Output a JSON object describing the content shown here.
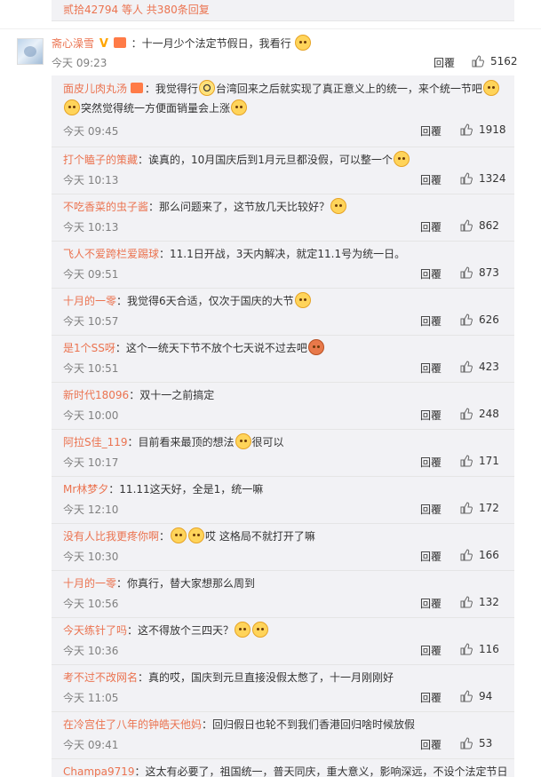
{
  "top": {
    "text": "贰拾42794 等人 共380条回复"
  },
  "comment": {
    "username": "斋心澡雪",
    "verified": "V",
    "text": "：十一月少个法定节假日，我看行",
    "time": "今天 09:23",
    "reply_label": "回覆",
    "likes": "5162"
  },
  "replies": [
    {
      "name": "面皮儿肉丸汤",
      "pre": "",
      "text": "：我觉得行",
      "text2": "台湾回来之后就实现了真正意义上的统一，来个统一节吧",
      "text3": "突然觉得统一方便面销量会上涨",
      "time": "今天 09:45",
      "reply": "回覆",
      "likes": "1918"
    },
    {
      "name": "打个瞌子的策藏",
      "text": "：诶真的，10月国庆后到1月元旦都没假，可以整一个",
      "time": "今天 10:13",
      "reply": "回覆",
      "likes": "1324"
    },
    {
      "name": "不吃香菜的虫子酱",
      "text": "：那么问题来了，这节放几天比较好？",
      "time": "今天 10:13",
      "reply": "回覆",
      "likes": "862"
    },
    {
      "name": "飞人不爱跨栏爱踢球",
      "text": "：11.1日开战，3天内解决，就定11.1号为统一日。",
      "time": "今天 09:51",
      "reply": "回覆",
      "likes": "873"
    },
    {
      "name": "十月的一零",
      "text": "：我觉得6天合适，仅次于国庆的大节",
      "time": "今天 10:57",
      "reply": "回覆",
      "likes": "626"
    },
    {
      "name": "是1个SS呀",
      "text": "：这个一统天下节不放个七天说不过去吧",
      "time": "今天 10:51",
      "reply": "回覆",
      "likes": "423"
    },
    {
      "name": "新时代18096",
      "text": "：双十一之前搞定",
      "time": "今天 10:00",
      "reply": "回覆",
      "likes": "248"
    },
    {
      "name": "阿拉S佳_119",
      "text": "：目前看来最顶的想法",
      "text2": "很可以",
      "time": "今天 10:17",
      "reply": "回覆",
      "likes": "171"
    },
    {
      "name": "Mr林梦夕",
      "text": "：11.11这天好，全是1，统一嘛",
      "time": "今天 12:10",
      "reply": "回覆",
      "likes": "172"
    },
    {
      "name": "没有人比我更疼你啊",
      "text": "：",
      "text2": "哎  这格局不就打开了嘛",
      "time": "今天 10:30",
      "reply": "回覆",
      "likes": "166"
    },
    {
      "name": "十月的一零",
      "text": "：你真行，替大家想那么周到",
      "time": "今天 10:56",
      "reply": "回覆",
      "likes": "132"
    },
    {
      "name": "今天练针了吗",
      "text": "：这不得放个三四天？",
      "time": "今天 10:36",
      "reply": "回覆",
      "likes": "116"
    },
    {
      "name": "考不过不改网名",
      "text": "：真的哎，国庆到元旦直接没假太憋了，十一月刚刚好",
      "time": "今天 11:05",
      "reply": "回覆",
      "likes": "94"
    },
    {
      "name": "在冷宫住了八年的钟皓天他妈",
      "text": "：回归假日也轮不到我们香港回归啥时候放假",
      "time": "今天 09:41",
      "reply": "回覆",
      "likes": "53"
    },
    {
      "name": "Champa9719",
      "text": "：这太有必要了，祖国统一，普天同庆，重大意义，影响深远，不设个法定节日",
      "time": "",
      "reply": "",
      "likes": ""
    }
  ]
}
